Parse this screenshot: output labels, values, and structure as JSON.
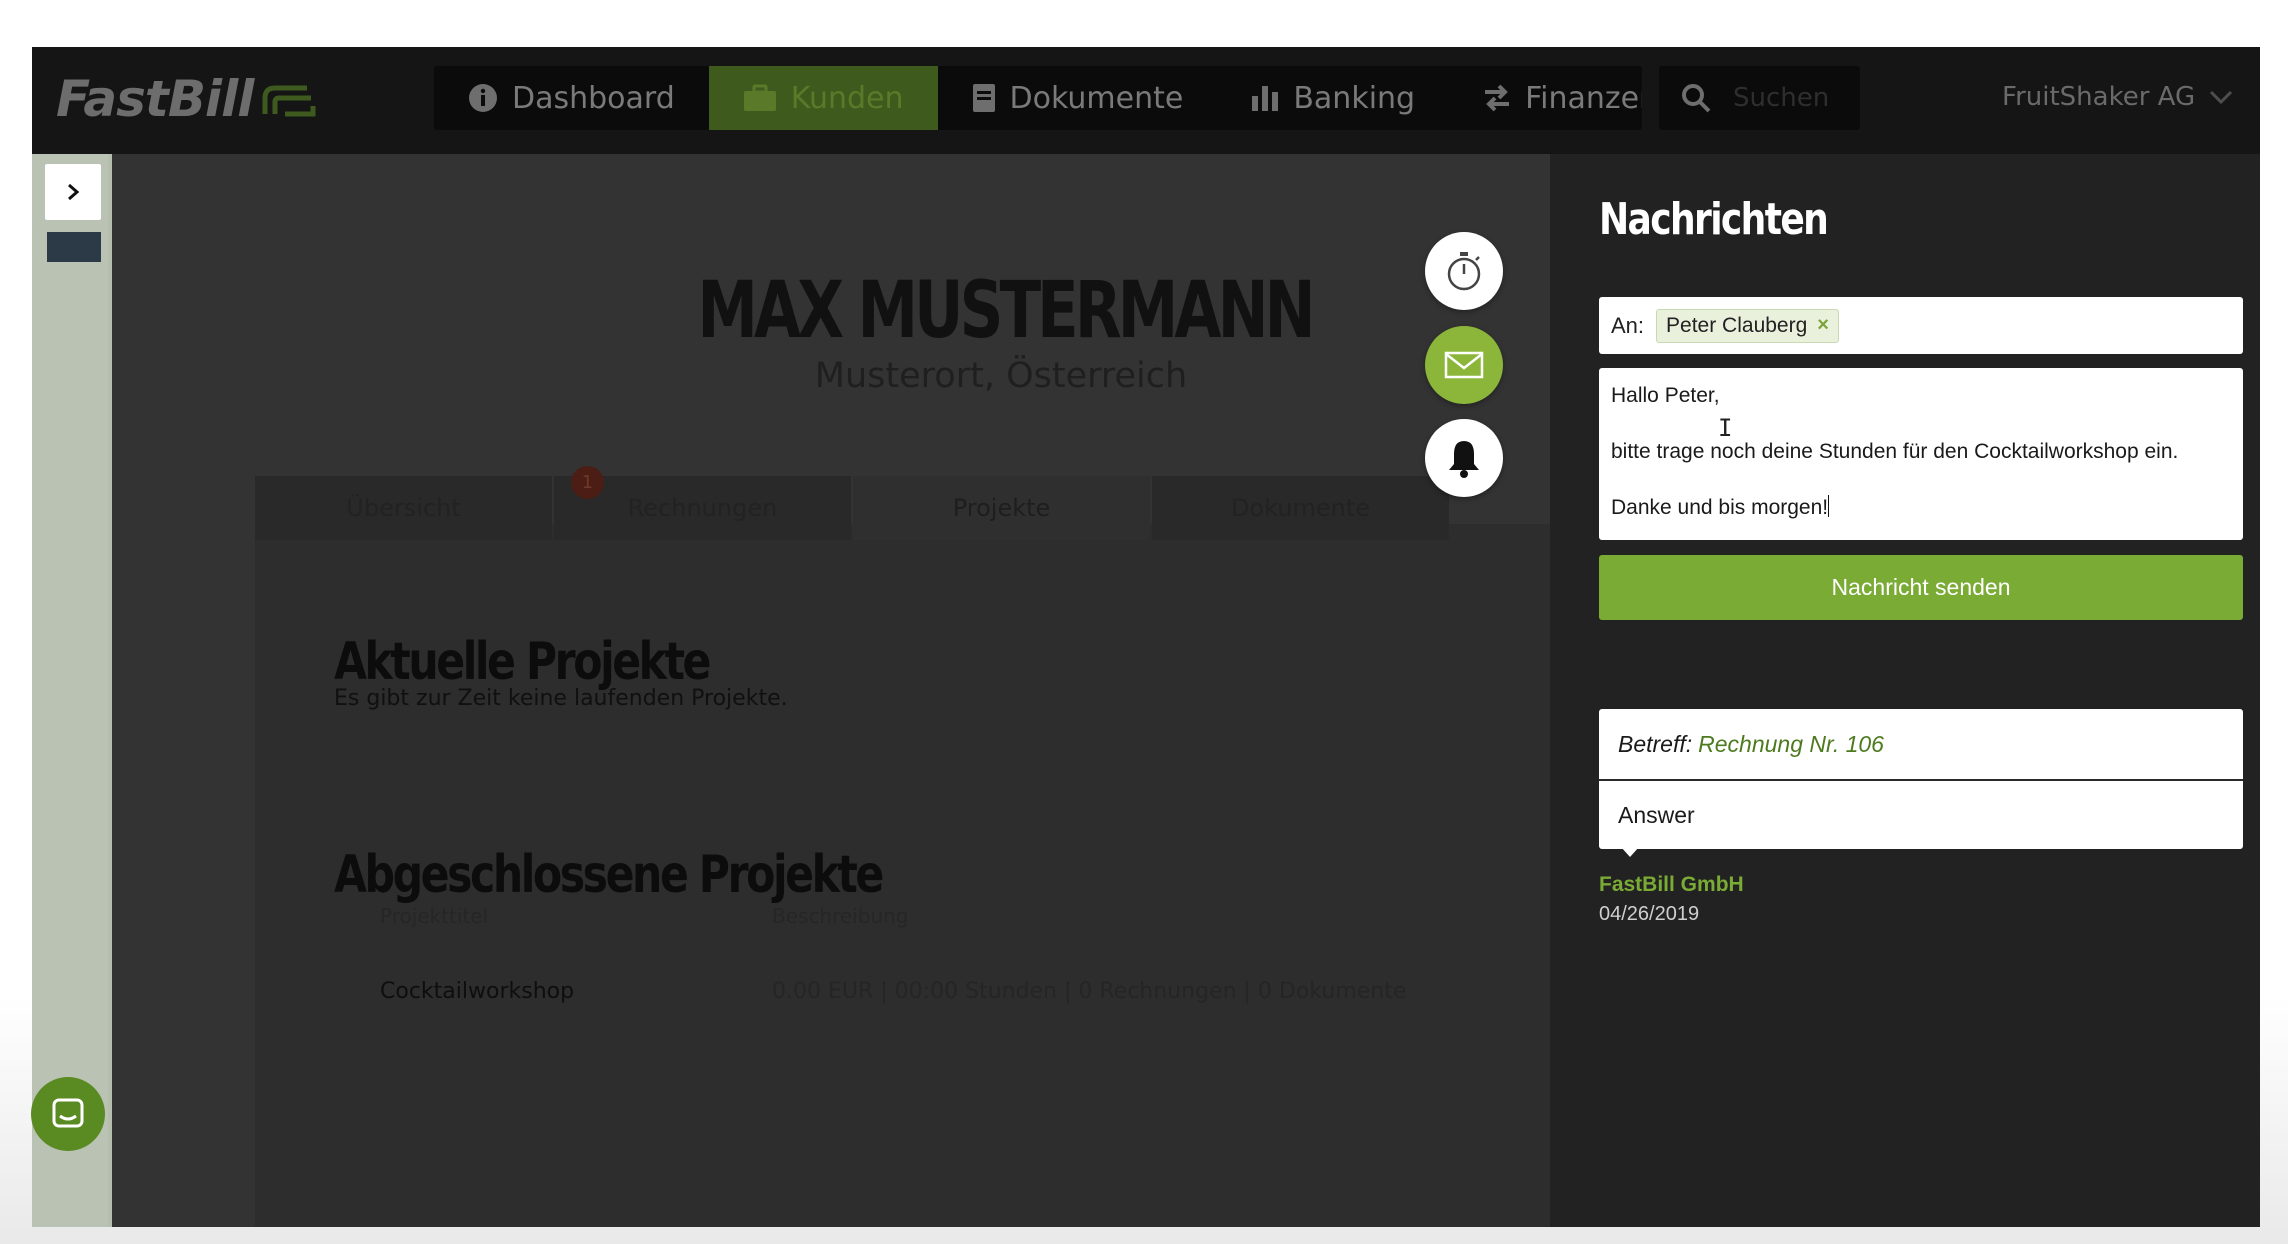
{
  "header": {
    "logo_text": "FastBill",
    "nav": [
      {
        "label": "Dashboard",
        "icon": "info-circle-icon"
      },
      {
        "label": "Kunden",
        "icon": "briefcase-icon",
        "active": true
      },
      {
        "label": "Dokumente",
        "icon": "document-icon"
      },
      {
        "label": "Banking",
        "icon": "bar-chart-icon"
      },
      {
        "label": "Finanzen",
        "icon": "transfer-arrows-icon"
      }
    ],
    "search_placeholder": "Suchen",
    "company": "FruitShaker AG"
  },
  "customer": {
    "name": "MAX MUSTERMANN",
    "location": "Musterort, Österreich"
  },
  "tabs": [
    {
      "label": "Übersicht"
    },
    {
      "label": "Rechnungen",
      "badge": "1"
    },
    {
      "label": "Projekte",
      "active": true
    },
    {
      "label": "Dokumente"
    }
  ],
  "projects": {
    "current_title": "Aktuelle Projekte",
    "current_empty": "Es gibt zur Zeit keine laufenden Projekte.",
    "closed_title": "Abgeschlossene Projekte",
    "columns": [
      "Projekttitel",
      "Beschreibung"
    ],
    "rows": [
      {
        "title": "Cocktailworkshop",
        "description": "0.00 EUR | 00:00 Stunden | 0 Rechnungen | 0 Dokumente"
      }
    ]
  },
  "messages": {
    "title": "Nachrichten",
    "to_label": "An:",
    "recipient": "Peter Clauberg",
    "recipient_remove": "×",
    "body_lines": [
      "Hallo Peter,",
      "bitte trage noch deine Stunden für den Cocktailworkshop ein.",
      "Danke und bis morgen!"
    ],
    "send_label": "Nachricht senden",
    "thread": {
      "subject_label": "Betreff:",
      "subject_value": "Rechnung Nr. 106",
      "answer": "Answer",
      "sender": "FastBill GmbH",
      "date": "04/26/2019"
    }
  },
  "colors": {
    "accent_green": "#7aab35",
    "panel_bg": "#222222",
    "nav_bg": "#151515"
  }
}
